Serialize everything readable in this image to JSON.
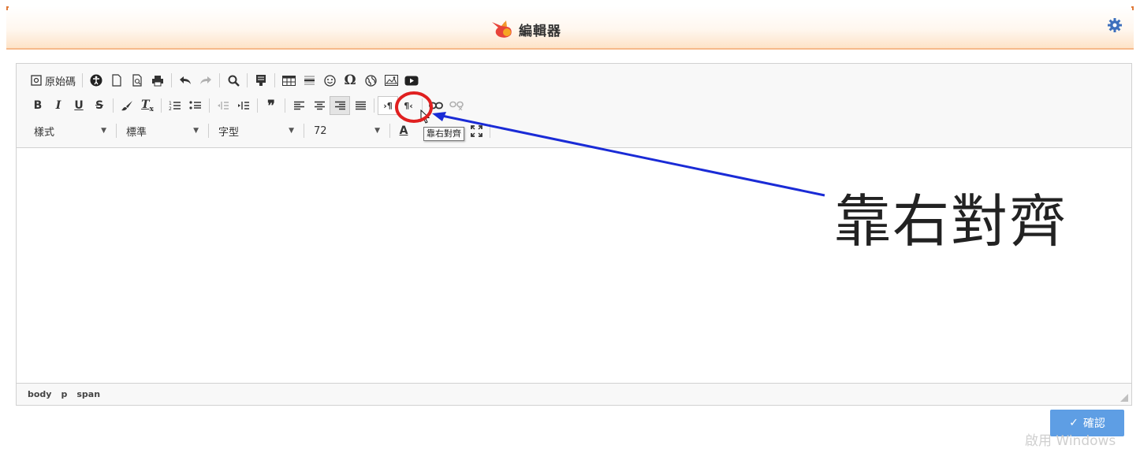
{
  "header": {
    "title": "編輯器",
    "logo_icon": "bird-logo",
    "settings_icon": "gear-icon"
  },
  "toolbar": {
    "row1": {
      "source_label": "原始碼"
    },
    "row3": {
      "style_combo": "樣式",
      "format_combo": "標準",
      "font_combo": "字型",
      "size_combo": "72",
      "text_color_label": "A"
    }
  },
  "tooltip": {
    "text": "靠右對齊"
  },
  "statusbar": {
    "path": [
      "body",
      "p",
      "span"
    ]
  },
  "confirm": {
    "label": "確認"
  },
  "annotation": {
    "label": "靠右對齊",
    "color": "#1a2bd6",
    "circle_color": "#e02020"
  },
  "watermark": "啟用 Windows",
  "colors": {
    "header_border": "#f6b98a",
    "confirm_bg": "#5e9ee4"
  }
}
